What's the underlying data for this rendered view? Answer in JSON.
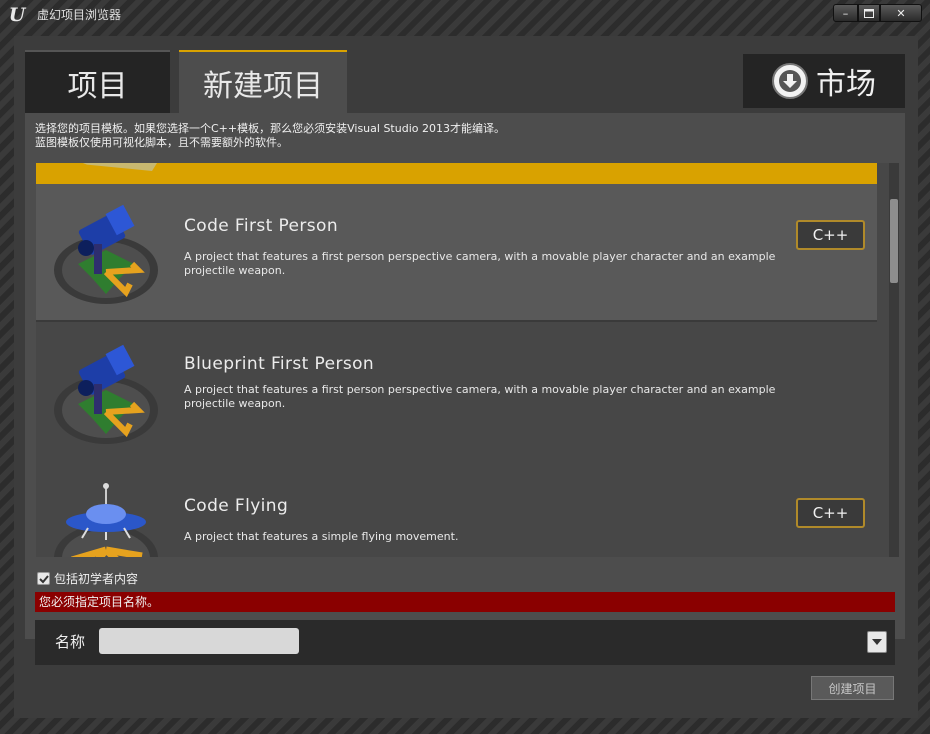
{
  "window": {
    "title": "虚幻项目浏览器",
    "logo_text": "U",
    "min_glyph": "–",
    "close_glyph": "✕"
  },
  "tabs": [
    {
      "label": "项目",
      "active": false
    },
    {
      "label": "新建项目",
      "active": true
    }
  ],
  "market": {
    "label": "市场",
    "icon": "download-circle-icon"
  },
  "description": {
    "line1": "选择您的项目模板。如果您选择一个C++模板，那么您必须安装Visual Studio 2013才能编译。",
    "line2": "蓝图模板仅使用可视化脚本，且不需要额外的软件。"
  },
  "templates": [
    {
      "title": "Code First Person",
      "description": "A project that features a first person perspective camera, with a movable player character and an example projectile weapon.",
      "badge": "C++",
      "selected": true,
      "icon": "first-person-camera-icon"
    },
    {
      "title": "Blueprint First Person",
      "description": "A project that features a first person perspective camera, with a movable player character and an example projectile weapon.",
      "badge": "",
      "selected": false,
      "icon": "first-person-camera-icon"
    },
    {
      "title": "Code Flying",
      "description": "A project that features a simple flying movement.",
      "badge": "C++",
      "selected": false,
      "icon": "flying-saucer-icon"
    }
  ],
  "starter_content": {
    "label": "包括初学者内容",
    "checked": true
  },
  "error": {
    "message": "您必须指定项目名称。"
  },
  "name_field": {
    "label": "名称",
    "value": ""
  },
  "create_button": {
    "label": "创建项目"
  },
  "colors": {
    "accent": "#d9a200",
    "error": "#8a0000",
    "panel": "#4d4d4d",
    "frame": "#3c3c3c"
  }
}
